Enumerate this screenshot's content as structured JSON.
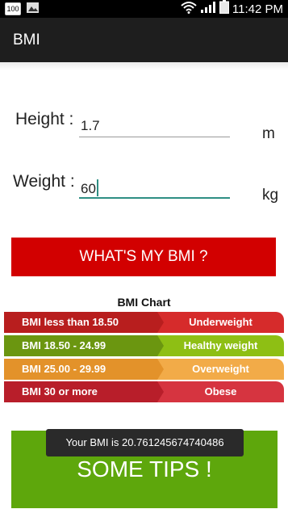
{
  "status_bar": {
    "battery_percent": "100",
    "time": "11:42 PM",
    "icons": [
      "battery-icon",
      "image-icon",
      "wifi-icon",
      "signal-icon",
      "battery-icon"
    ]
  },
  "app_bar": {
    "title": "BMI"
  },
  "form": {
    "height_label": "Height :",
    "height_value": "1.7",
    "height_unit": "m",
    "weight_label": "Weight :",
    "weight_value": "60",
    "weight_unit": "kg"
  },
  "bmi_button": {
    "label": "WHAT'S MY BMI ?",
    "color": "#d20000"
  },
  "chart": {
    "title": "BMI Chart",
    "rows": [
      {
        "range": "BMI less than 18.50",
        "category": "Underweight",
        "color": "#d62b2b"
      },
      {
        "range": "BMI 18.50 - 24.99",
        "category": "Healthy weight",
        "color": "#7fae12"
      },
      {
        "range": "BMI 25.00 - 29.99",
        "category": "Overweight",
        "color": "#f0a23a"
      },
      {
        "range": "BMI 30 or more",
        "category": "Obese",
        "color": "#cc2430"
      }
    ]
  },
  "tips_button": {
    "label": "SOME TIPS !",
    "color": "#5ea70c"
  },
  "toast": {
    "text": "Your BMI is 20.761245674740486"
  }
}
